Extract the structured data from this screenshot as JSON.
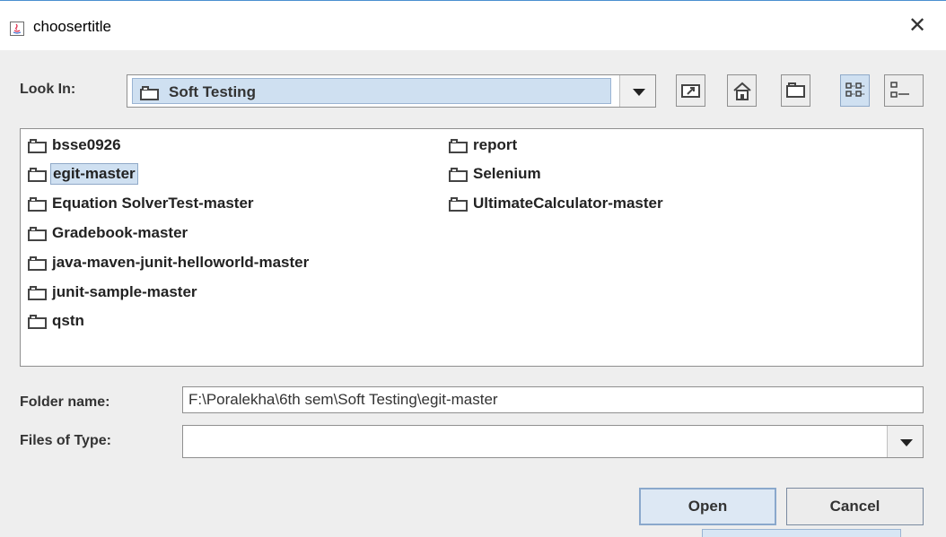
{
  "window": {
    "title": "choosertitle"
  },
  "look_in": {
    "label": "Look In:",
    "value": "Soft Testing"
  },
  "toolbar": {
    "up_folder": "up-one-level-icon",
    "home": "home-icon",
    "new_folder": "new-folder-icon",
    "list_view": "list-view-icon",
    "details_view": "details-view-icon"
  },
  "files": {
    "column1": [
      "bsse0926",
      "egit-master",
      "Equation SolverTest-master",
      "Gradebook-master",
      "java-maven-junit-helloworld-master",
      "junit-sample-master",
      "qstn"
    ],
    "column2": [
      "report",
      "Selenium",
      "UltimateCalculator-master"
    ],
    "selected": "egit-master"
  },
  "folder_name": {
    "label": "Folder name:",
    "value": "F:\\Poralekha\\6th sem\\Soft Testing\\egit-master"
  },
  "files_of_type": {
    "label": "Files of Type:",
    "value": ""
  },
  "buttons": {
    "open": "Open",
    "cancel": "Cancel"
  },
  "colors": {
    "selection": "#cfe0f1",
    "window_border": "#4a8fd0",
    "background": "#eeeeee"
  }
}
